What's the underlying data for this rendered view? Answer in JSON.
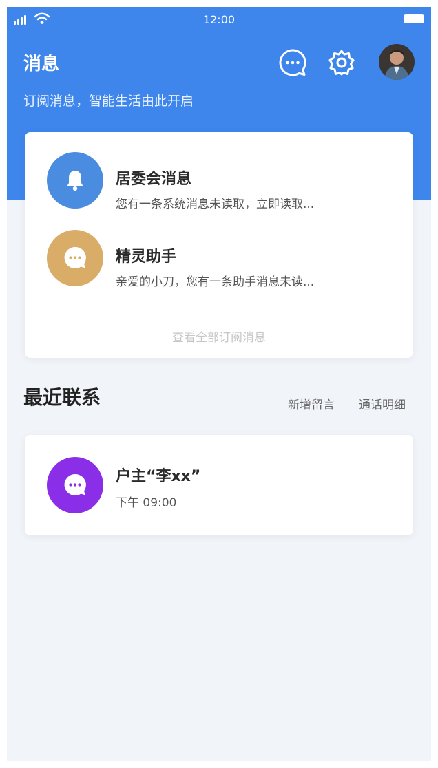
{
  "status_bar": {
    "time": "12:00"
  },
  "header": {
    "title": "消息",
    "subtitle": "订阅消息，智能生活由此开启"
  },
  "colors": {
    "primary": "#3e86ec",
    "bell_bg": "#4a8de0",
    "assistant_bg": "#d9ac68",
    "contact_bg": "#8a2ee8",
    "page_bg": "#f1f4f8"
  },
  "subscriptions": {
    "items": [
      {
        "title": "居委会消息",
        "desc": "您有一条系统消息未读取，立即读取...",
        "icon": "bell-icon"
      },
      {
        "title": "精灵助手",
        "desc": "亲爱的小刀，您有一条助手消息未读...",
        "icon": "chat-bubble-icon"
      }
    ],
    "view_all": "查看全部订阅消息"
  },
  "recent": {
    "title": "最近联系",
    "new_message": "新增留言",
    "call_details": "通话明细",
    "contacts": [
      {
        "name": "户主“李xx”",
        "time": "下午 09:00",
        "icon": "chat-bubble-icon"
      }
    ]
  }
}
